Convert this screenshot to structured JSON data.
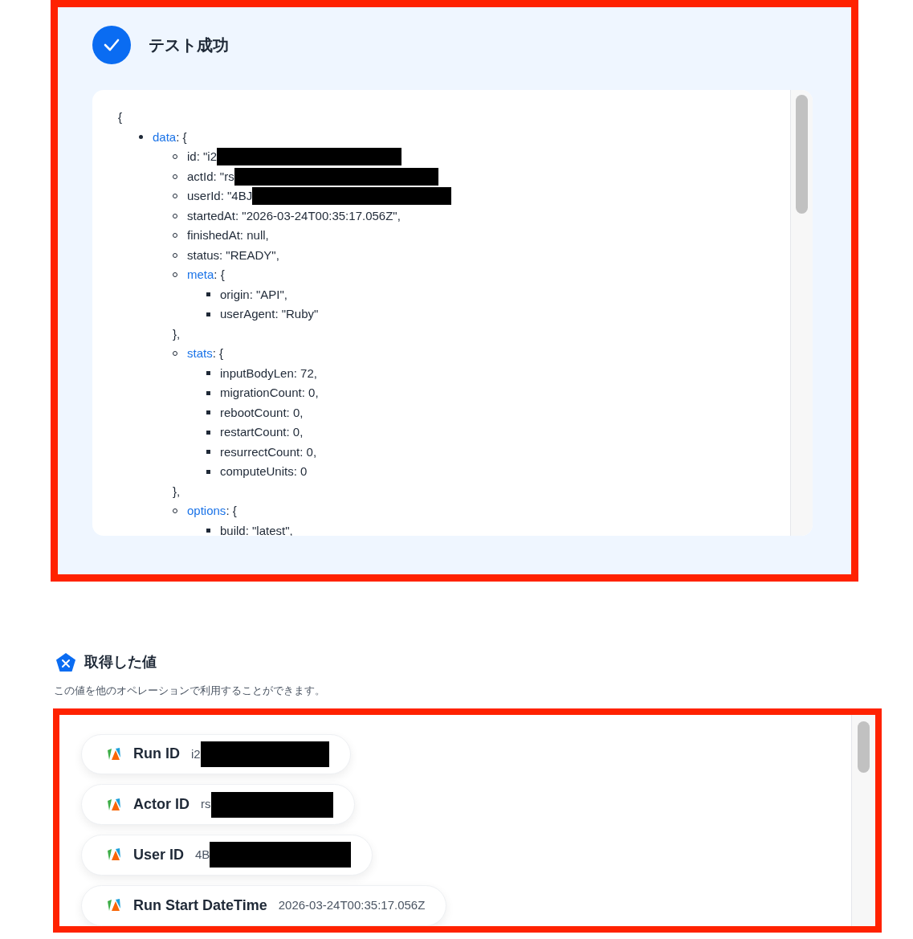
{
  "test_result": {
    "title": "テスト成功",
    "success": true,
    "json_view": {
      "open": "{",
      "items": [
        {
          "key": "data",
          "open": ": {",
          "children": [
            {
              "text": "id: \"i2",
              "redacted": true
            },
            {
              "text": "actId: \"rs",
              "redacted": true
            },
            {
              "text": "userId: \"4BJ",
              "redacted": true
            },
            {
              "text": "startedAt: \"2026-03-24T00:35:17.056Z\",",
              "redacted": false
            },
            {
              "text": "finishedAt: null,",
              "redacted": false
            },
            {
              "text": "status: \"READY\",",
              "redacted": false
            },
            {
              "key": "meta",
              "open": ": {",
              "close": "},",
              "children": [
                {
                  "text": "origin: \"API\",",
                  "redacted": false
                },
                {
                  "text": "userAgent: \"Ruby\"",
                  "redacted": false
                }
              ]
            },
            {
              "key": "stats",
              "open": ": {",
              "close": "},",
              "children": [
                {
                  "text": "inputBodyLen: 72,",
                  "redacted": false
                },
                {
                  "text": "migrationCount: 0,",
                  "redacted": false
                },
                {
                  "text": "rebootCount: 0,",
                  "redacted": false
                },
                {
                  "text": "restartCount: 0,",
                  "redacted": false
                },
                {
                  "text": "resurrectCount: 0,",
                  "redacted": false
                },
                {
                  "text": "computeUnits: 0",
                  "redacted": false
                }
              ]
            },
            {
              "key": "options",
              "open": ": {",
              "children": [
                {
                  "text": "build: \"latest\",",
                  "redacted": false
                }
              ]
            }
          ]
        }
      ]
    }
  },
  "acquired_values": {
    "title": "取得した値",
    "description": "この値を他のオペレーションで利用することができます。",
    "chips": [
      {
        "label": "Run ID",
        "value": "i2",
        "redacted": true
      },
      {
        "label": "Actor ID",
        "value": "rs",
        "redacted": true
      },
      {
        "label": "User ID",
        "value": "4B",
        "redacted": true
      },
      {
        "label": "Run Start DateTime",
        "value": "2026-03-24T00:35:17.056Z",
        "redacted": false
      }
    ]
  }
}
